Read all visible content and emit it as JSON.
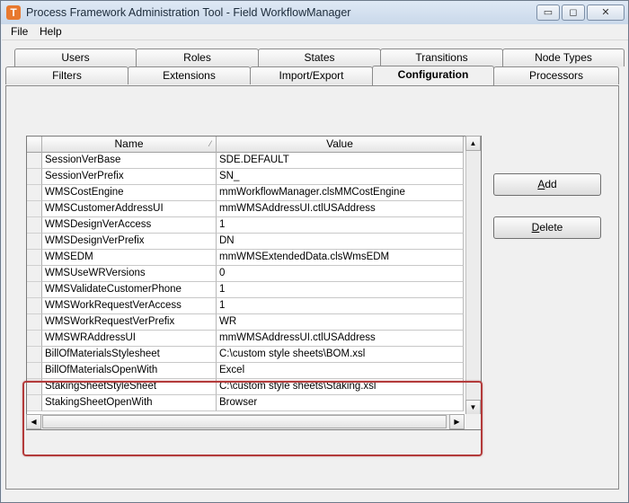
{
  "window": {
    "title": "Process Framework Administration Tool - Field WorkflowManager",
    "app_icon": "T",
    "min_glyph": "▭",
    "max_glyph": "◻",
    "close_glyph": "✕"
  },
  "menu": [
    "File",
    "Help"
  ],
  "tabs_back": [
    "Users",
    "Roles",
    "States",
    "Transitions",
    "Node Types"
  ],
  "tabs_front": [
    "Filters",
    "Extensions",
    "Import/Export",
    "Configuration",
    "Processors"
  ],
  "active_tab": "Configuration",
  "grid": {
    "columns": [
      "Name",
      "Value"
    ],
    "rows": [
      {
        "name": "SessionVerBase",
        "value": "SDE.DEFAULT"
      },
      {
        "name": "SessionVerPrefix",
        "value": "SN_"
      },
      {
        "name": "WMSCostEngine",
        "value": "mmWorkflowManager.clsMMCostEngine"
      },
      {
        "name": "WMSCustomerAddressUI",
        "value": "mmWMSAddressUI.ctlUSAddress"
      },
      {
        "name": "WMSDesignVerAccess",
        "value": "1"
      },
      {
        "name": "WMSDesignVerPrefix",
        "value": "DN"
      },
      {
        "name": "WMSEDM",
        "value": "mmWMSExtendedData.clsWmsEDM"
      },
      {
        "name": "WMSUseWRVersions",
        "value": "0"
      },
      {
        "name": "WMSValidateCustomerPhone",
        "value": "1"
      },
      {
        "name": "WMSWorkRequestVerAccess",
        "value": "1"
      },
      {
        "name": "WMSWorkRequestVerPrefix",
        "value": "WR"
      },
      {
        "name": "WMSWRAddressUI",
        "value": "mmWMSAddressUI.ctlUSAddress"
      },
      {
        "name": "BillOfMaterialsStylesheet",
        "value": "C:\\custom style sheets\\BOM.xsl"
      },
      {
        "name": "BillOfMaterialsOpenWith",
        "value": "Excel"
      },
      {
        "name": "StakingSheetStyleSheet",
        "value": "C:\\custom style sheets\\Staking.xsl"
      },
      {
        "name": "StakingSheetOpenWith",
        "value": "Browser"
      }
    ]
  },
  "buttons": {
    "add": {
      "accel": "A",
      "rest": "dd"
    },
    "delete": {
      "accel": "D",
      "rest": "elete"
    }
  },
  "colors": {
    "highlight_border": "#b33a3a"
  }
}
